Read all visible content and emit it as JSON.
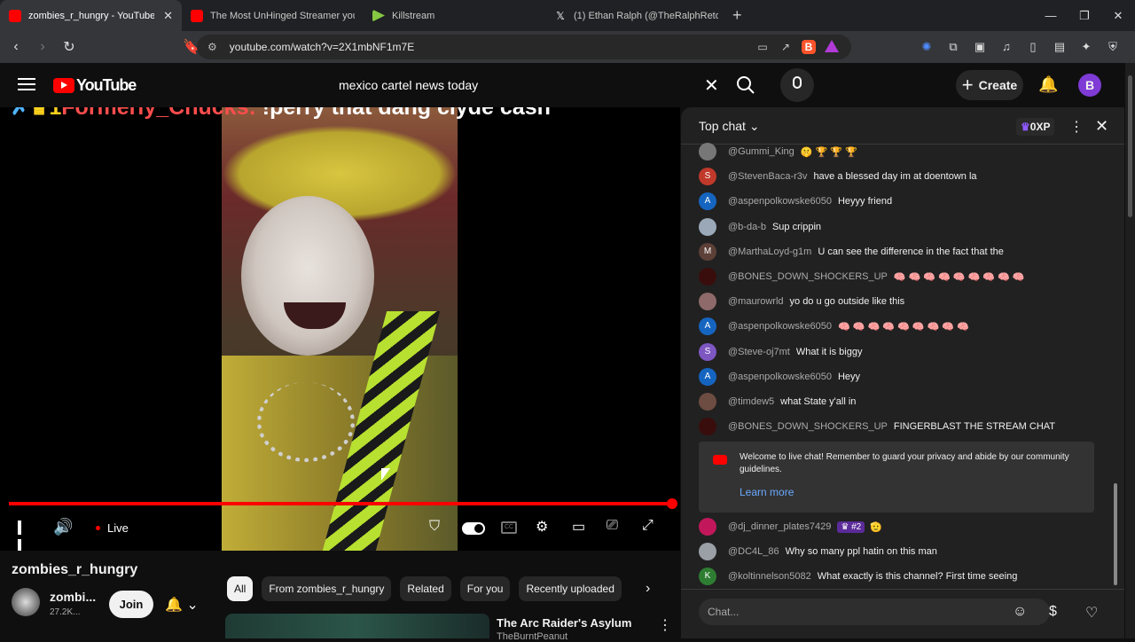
{
  "browser": {
    "tabs": [
      {
        "title": "zombies_r_hungry - YouTube",
        "active": true,
        "favicon": "youtube-icon"
      },
      {
        "title": "The Most UnHinged Streamer you've",
        "favicon": "youtube-icon"
      },
      {
        "title": "Killstream",
        "favicon": "rumble-icon"
      },
      {
        "title": "(1) Ethan Ralph (@TheRalphRetort) /",
        "favicon": "x-icon"
      }
    ],
    "url": "youtube.com/watch?v=2X1mbNF1m7E",
    "colors": {
      "youtube": "#ff0000",
      "rumble": "#85c742"
    }
  },
  "youtube": {
    "logo": "YouTube",
    "search_value": "mexico cartel news today",
    "create_label": "Create",
    "avatar_letter": "B"
  },
  "player": {
    "overlay": {
      "badge_num": "1",
      "name": "Formerly_Chucks:",
      "message": "!perry that dang clyde cash"
    },
    "live_label": "Live",
    "cc": "CC"
  },
  "channel": {
    "title": "zombies_r_hungry",
    "short_name": "zombi...",
    "subs": "27.2K...",
    "join_label": "Join"
  },
  "chips": [
    "All",
    "From zombies_r_hungry",
    "Related",
    "For you",
    "Recently uploaded"
  ],
  "recommended": {
    "title": "The Arc Raider's Asylum",
    "author": "TheBurntPeanut"
  },
  "chat": {
    "header": "Top chat",
    "xp": "0XP",
    "messages": [
      {
        "author": "@Gummi_King",
        "text": "",
        "emojis": "🤫 🏆 🏆 🏆",
        "avatar_color": "#777777",
        "initial": ""
      },
      {
        "author": "@StevenBaca-r3v",
        "text": "have a blessed day im at doentown la",
        "emojis": "",
        "avatar_color": "#c0392b",
        "initial": "S"
      },
      {
        "author": "@aspenpolkowske6050",
        "text": "Heyyy friend",
        "emojis": "",
        "avatar_color": "#1565c0",
        "initial": "A"
      },
      {
        "author": "@b-da-b",
        "text": "Sup crippin",
        "emojis": "",
        "avatar_color": "#9aa8b8",
        "initial": ""
      },
      {
        "author": "@MarthaLoyd-g1m",
        "text": "U can see the difference in the fact that the",
        "emojis": "",
        "avatar_color": "#5d4037",
        "initial": "M"
      },
      {
        "author": "@BONES_DOWN_SHOCKERS_UP",
        "text": "",
        "emojis": "🧠 🧠 🧠 🧠 🧠 🧠 🧠 🧠 🧠",
        "avatar_color": "#3a0d0d",
        "initial": ""
      },
      {
        "author": "@maurowrld",
        "text": "yo do u go outside like this",
        "emojis": "",
        "avatar_color": "#8e6a6a",
        "initial": ""
      },
      {
        "author": "@aspenpolkowske6050",
        "text": "",
        "emojis": "🧠 🧠 🧠 🧠 🧠 🧠 🧠 🧠 🧠",
        "avatar_color": "#1565c0",
        "initial": "A"
      },
      {
        "author": "@Steve-oj7mt",
        "text": "What it is biggy",
        "emojis": "",
        "avatar_color": "#7e57c2",
        "initial": "S"
      },
      {
        "author": "@aspenpolkowske6050",
        "text": "Heyy",
        "emojis": "",
        "avatar_color": "#1565c0",
        "initial": "A"
      },
      {
        "author": "@timdew5",
        "text": "what State y'all in",
        "emojis": "",
        "avatar_color": "#6d4c41",
        "initial": ""
      },
      {
        "author": "@BONES_DOWN_SHOCKERS_UP",
        "text": "FINGERBLAST THE STREAM CHAT",
        "emojis": "",
        "avatar_color": "#3a0d0d",
        "initial": ""
      }
    ],
    "welcome_text": "Welcome to live chat! Remember to guard your privacy and abide by our community guidelines.",
    "learn_more": "Learn more",
    "messages2": [
      {
        "author": "@dj_dinner_plates7429",
        "badge": "♛ #2",
        "text": "",
        "emojis": "🫡",
        "avatar_color": "#c2185b",
        "initial": ""
      },
      {
        "author": "@DC4L_86",
        "text": "Why so many ppl hatin on this man",
        "emojis": "",
        "avatar_color": "#9aa0a6",
        "initial": ""
      },
      {
        "author": "@koltinnelson5082",
        "text": "What exactly is this channel? First time seeing",
        "emojis": "",
        "avatar_color": "#2e7d32",
        "initial": "K"
      }
    ],
    "input_placeholder": "Chat..."
  }
}
